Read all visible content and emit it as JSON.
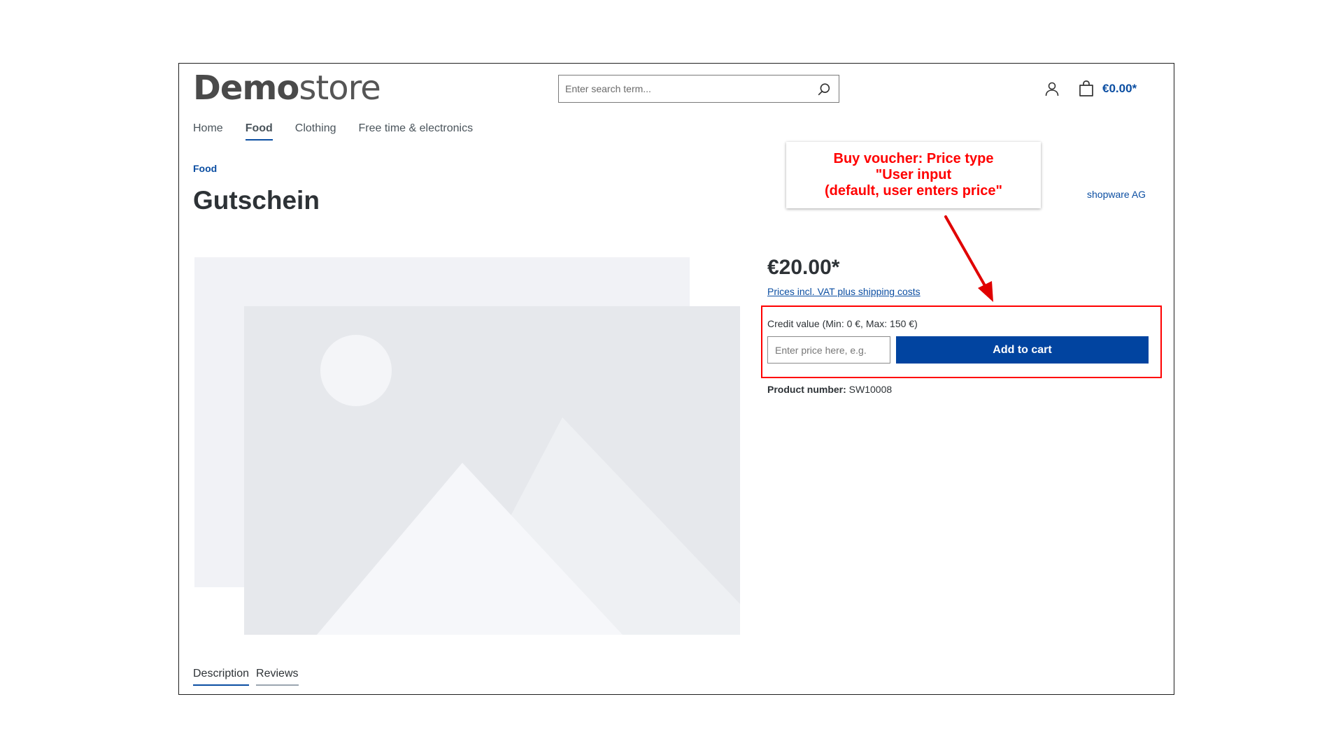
{
  "header": {
    "logo_bold": "Demo",
    "logo_light": "store",
    "search_placeholder": "Enter search term...",
    "cart_total": "€0.00*"
  },
  "nav": {
    "items": [
      {
        "label": "Home",
        "active": false
      },
      {
        "label": "Food",
        "active": true
      },
      {
        "label": "Clothing",
        "active": false
      },
      {
        "label": "Free time & electronics",
        "active": false
      }
    ]
  },
  "product": {
    "breadcrumb": "Food",
    "title": "Gutschein",
    "manufacturer": "shopware AG",
    "price": "€20.00*",
    "price_note": "Prices incl. VAT plus shipping costs",
    "credit_label": "Credit value (Min: 0 €, Max: 150 €)",
    "price_input_placeholder": "Enter price here, e.g.",
    "add_to_cart_label": "Add to cart",
    "product_number_label": "Product number:",
    "product_number_value": "SW10008"
  },
  "annotation": {
    "text": "Buy voucher: Price type\n\"User input\n(default, user enters price\"",
    "color": "#ff0000"
  },
  "tabs": [
    {
      "label": "Description",
      "active": true
    },
    {
      "label": "Reviews",
      "active": false
    }
  ],
  "colors": {
    "accent": "#0b4ea2",
    "button": "#0144a0",
    "highlight": "#ff0000"
  }
}
